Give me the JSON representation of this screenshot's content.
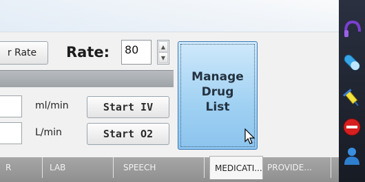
{
  "toolbar": {
    "rate_button_label": "r Rate",
    "rate_label": "Rate:",
    "rate_value": "80"
  },
  "iv_row": {
    "unit": "ml/min",
    "button_label": "Start IV"
  },
  "o2_row": {
    "unit": "L/min",
    "button_label": "Start O2"
  },
  "manage_button": {
    "label": "Manage\nDrug\nList"
  },
  "tabs": [
    {
      "label": "R"
    },
    {
      "label": "LAB"
    },
    {
      "label": "SPEECH"
    },
    {
      "label": "MEDICATI..."
    },
    {
      "label": "PROVIDE..."
    }
  ],
  "active_tab": "MEDICATI...",
  "sidebar_icons": [
    "headset-icon",
    "pill-icon",
    "syringe-icon",
    "no-entry-icon",
    "person-icon"
  ],
  "colors": {
    "manage_button_fill": "#9fd0f2",
    "tab_bar": "#9a9a9a",
    "sidebar": "#1f2430"
  }
}
